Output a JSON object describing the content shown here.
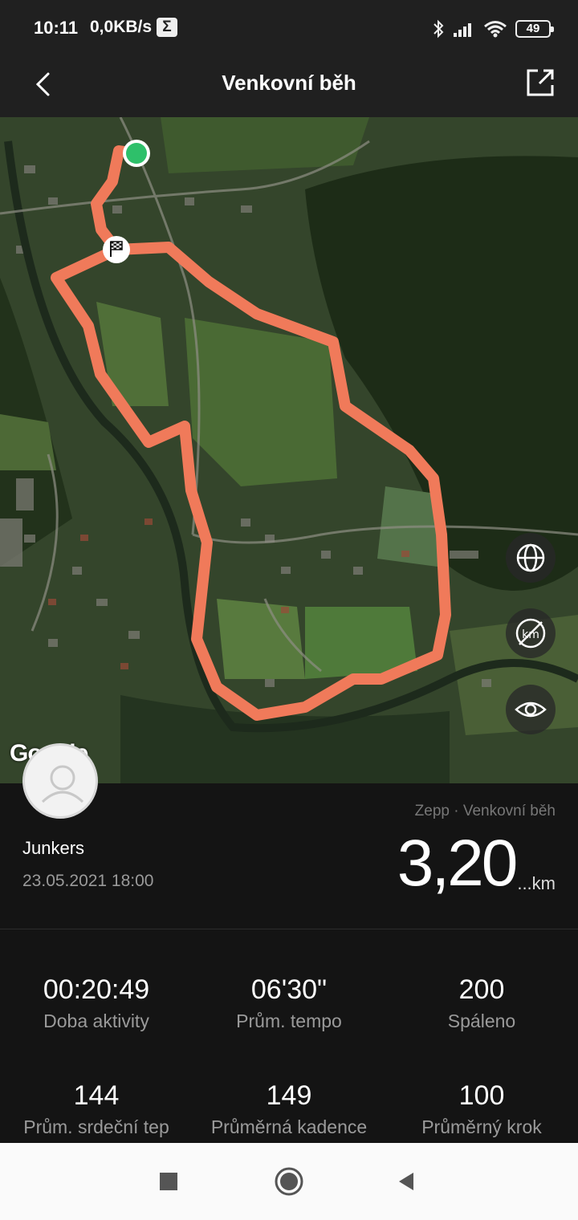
{
  "status_bar": {
    "time": "10:11",
    "speed": "0,0KB/s",
    "sigma": "Σ",
    "battery": "49"
  },
  "app_bar": {
    "title": "Venkovní běh"
  },
  "map": {
    "watermark": "Google",
    "route_color": "#F07A5A",
    "start_color": "#2EC06A"
  },
  "summary": {
    "user_name": "Junkers",
    "date": "23.05.2021 18:00",
    "source": "Zepp · Venkovní běh",
    "distance": "3,20",
    "distance_unit": "...km"
  },
  "stats": [
    {
      "value": "00:20:49",
      "label": "Doba aktivity"
    },
    {
      "value": "06'30\"",
      "label": "Prům. tempo"
    },
    {
      "value": "200",
      "label": "Spáleno"
    },
    {
      "value": "144",
      "label": "Prům. srdeční tep"
    },
    {
      "value": "149",
      "label": "Průměrná kadence"
    },
    {
      "value": "100",
      "label": "Průměrný krok"
    }
  ]
}
